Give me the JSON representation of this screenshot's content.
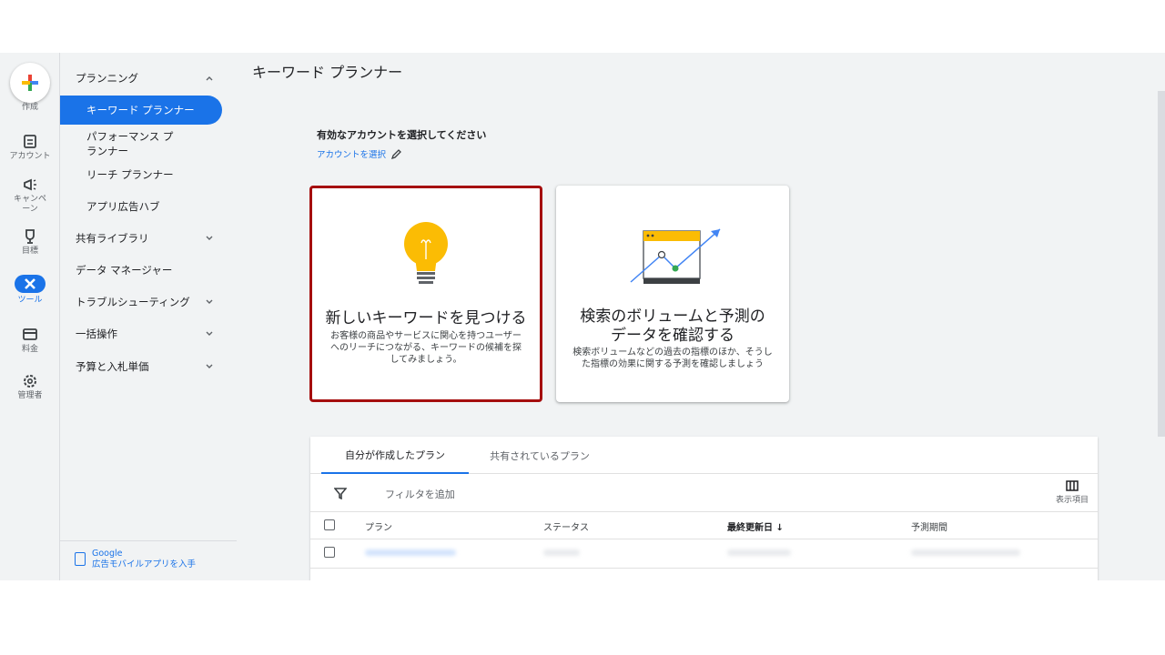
{
  "rail": {
    "create": "作成",
    "account": "アカウント",
    "campaign": "キャンペーン",
    "goals": "目標",
    "tools": "ツール",
    "billing": "料金",
    "admin": "管理者"
  },
  "nav": {
    "planning": "プランニング",
    "items": [
      "キーワード プランナー",
      "パフォーマンス プランナー",
      "リーチ プランナー",
      "アプリ広告ハブ"
    ],
    "shared_library": "共有ライブラリ",
    "data_manager": "データ マネージャー",
    "troubleshooting": "トラブルシューティング",
    "bulk": "一括操作",
    "budget": "予算と入札単価",
    "footer_line1": "Google",
    "footer_line2": "広告モバイルアプリを入手"
  },
  "main": {
    "title": "キーワード プランナー",
    "account_prompt": "有効なアカウントを選択してください",
    "account_link": "アカウントを選択",
    "card1_title": "新しいキーワードを見つける",
    "card1_desc": "お客様の商品やサービスに関心を持つユーザーへのリーチにつながる、キーワードの候補を探してみましょう。",
    "card2_title": "検索のボリュームと予測のデータを確認する",
    "card2_desc": "検索ボリュームなどの過去の指標のほか、そうした指標の効果に関する予測を確認しましょう"
  },
  "plans": {
    "tab_mine": "自分が作成したプラン",
    "tab_shared": "共有されているプラン",
    "filter_add": "フィルタを追加",
    "columns_label": "表示項目",
    "headers": {
      "plan": "プラン",
      "status": "ステータス",
      "last_updated": "最終更新日 ↓",
      "forecast_period": "予測期間"
    }
  },
  "colors": {
    "accent": "#1a73e8",
    "highlight_border": "#a50e0e",
    "bulb": "#fbbc04"
  }
}
